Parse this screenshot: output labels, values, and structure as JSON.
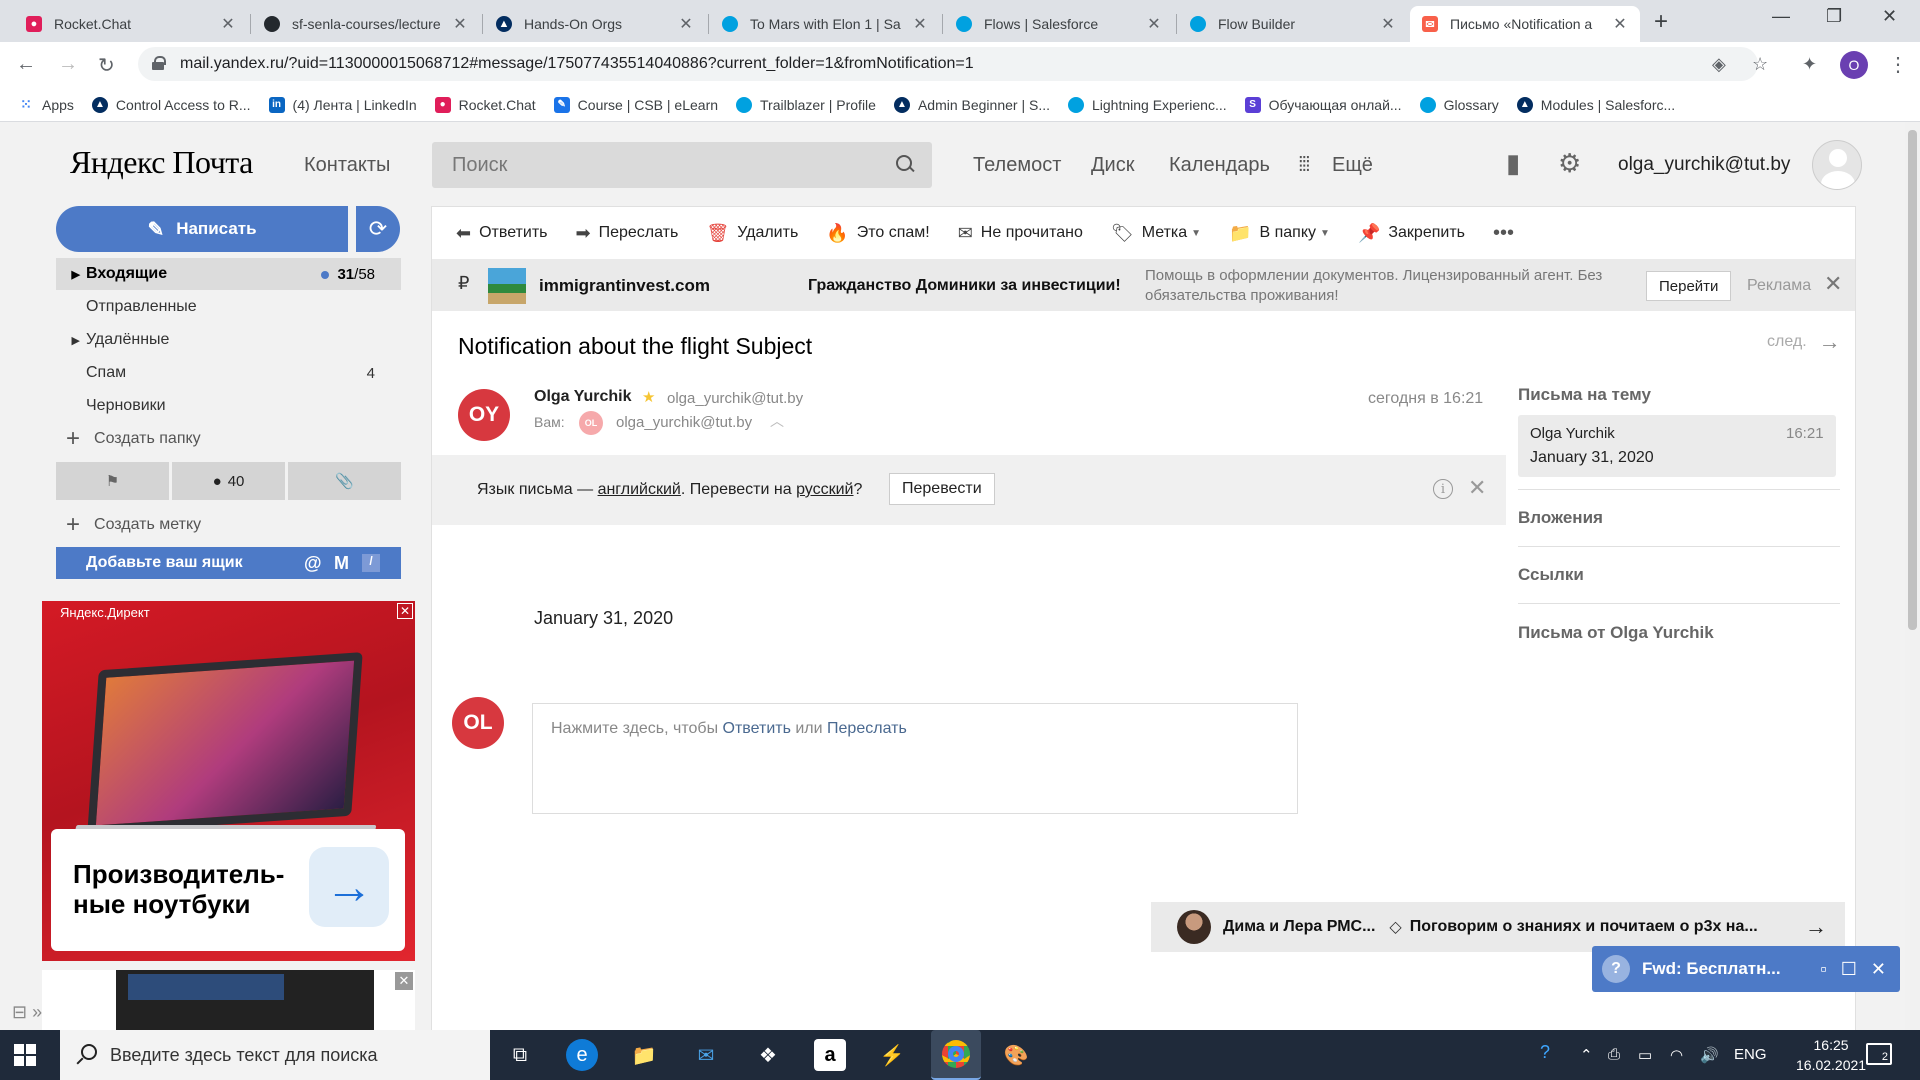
{
  "browser": {
    "tabs": [
      {
        "title": "Rocket.Chat",
        "icon": "rocketchat-icon",
        "color": "#e01e5a"
      },
      {
        "title": "sf-senla-courses/lecture",
        "icon": "github-icon",
        "color": "#24292e"
      },
      {
        "title": "Hands-On Orgs",
        "icon": "trailhead-icon",
        "color": "#032d60"
      },
      {
        "title": "To Mars with Elon 1 | Sa",
        "icon": "salesforce-cloud-icon",
        "color": "#00a1e0"
      },
      {
        "title": "Flows | Salesforce",
        "icon": "salesforce-cloud-icon",
        "color": "#00a1e0"
      },
      {
        "title": "Flow Builder",
        "icon": "salesforce-cloud-icon",
        "color": "#00a1e0"
      },
      {
        "title": "Письмо «Notification a",
        "icon": "yandex-mail-icon",
        "color": "#f8604a",
        "active": true
      }
    ],
    "url": "mail.yandex.ru/?uid=1130000015068712#message/175077435514040886?current_folder=1&fromNotification=1",
    "profile_initial": "O",
    "bookmarks": [
      {
        "label": "Apps",
        "icon": "apps-grid-icon",
        "color": "#4285f4"
      },
      {
        "label": "Control Access to R...",
        "icon": "trailhead-icon",
        "color": "#032d60"
      },
      {
        "label": "(4) Лента | LinkedIn",
        "icon": "linkedin-icon",
        "color": "#0a66c2"
      },
      {
        "label": "Rocket.Chat",
        "icon": "rocketchat-icon",
        "color": "#e01e5a"
      },
      {
        "label": "Course | CSB | eLearn",
        "icon": "elearn-icon",
        "color": "#1a73e8"
      },
      {
        "label": "Trailblazer | Profile",
        "icon": "salesforce-cloud-icon",
        "color": "#00a1e0"
      },
      {
        "label": "Admin Beginner | S...",
        "icon": "trailhead-icon",
        "color": "#032d60"
      },
      {
        "label": "Lightning Experienc...",
        "icon": "salesforce-cloud-icon",
        "color": "#00a1e0"
      },
      {
        "label": "Обучающая онлай...",
        "icon": "s-letter-icon",
        "color": "#5b3fd6"
      },
      {
        "label": "Glossary",
        "icon": "salesforce-cloud-icon",
        "color": "#00a1e0"
      },
      {
        "label": "Modules | Salesforc...",
        "icon": "trailhead-icon",
        "color": "#032d60"
      }
    ]
  },
  "header": {
    "logo_brand": "Яндекс",
    "logo_product": "Почта",
    "contacts": "Контакты",
    "search_placeholder": "Поиск",
    "nav": [
      "Телемост",
      "Диск",
      "Календарь",
      "Ещё"
    ],
    "user_email": "olga_yurchik@tut.by"
  },
  "sidebar": {
    "compose": "Написать",
    "folders": [
      {
        "name": "Входящие",
        "unread": "31",
        "total": "58",
        "selected": true,
        "expandable": true
      },
      {
        "name": "Отправленные"
      },
      {
        "name": "Удалённые",
        "expandable": true
      },
      {
        "name": "Спам",
        "count": "4"
      },
      {
        "name": "Черновики"
      }
    ],
    "create_folder": "Создать папку",
    "filter_unread_count": "40",
    "create_label": "Создать метку",
    "add_mailbox": "Добавьте ваш ящик"
  },
  "ad": {
    "label": "Яндекс.Директ",
    "title": "Производитель-ные ноутбуки",
    "title_line1": "Производитель-",
    "title_line2": "ные ноутбуки"
  },
  "toolbar": {
    "reply": "Ответить",
    "forward": "Переслать",
    "delete": "Удалить",
    "spam": "Это спам!",
    "unread": "Не прочитано",
    "label": "Метка",
    "to_folder": "В папку",
    "pin": "Закрепить"
  },
  "ad_strip": {
    "currency": "₽",
    "domain": "immigrantinvest.com",
    "headline": "Гражданство Доминики за инвестиции!",
    "description": "Помощь в оформлении документов. Лицензированный агент. Без обязательства проживания!",
    "go": "Перейти",
    "label": "Реклама"
  },
  "message": {
    "subject": "Notification about the flight Subject",
    "next": "след.",
    "sender_initials": "OY",
    "sender_name": "Olga Yurchik",
    "sender_email": "olga_yurchik@tut.by",
    "to_label": "Вам:",
    "to_initials": "OL",
    "to_email": "olga_yurchik@tut.by",
    "time": "сегодня в 16:21",
    "translate": {
      "prefix": "Язык письма — ",
      "lang_from": "английский",
      "middle": ". Перевести на ",
      "lang_to": "русский",
      "suffix": "?",
      "button": "Перевести"
    },
    "body": "January 31, 2020",
    "reply_initials": "OL",
    "reply_hint_prefix": "Нажмите здесь, чтобы ",
    "reply_link": "Ответить",
    "reply_or": " или ",
    "forward_link": "Переслать"
  },
  "related": {
    "from": "Дима и Лера РМС...",
    "subject": "Поговорим о знаниях и почитаем о р3х на..."
  },
  "right_panel": {
    "thread_title": "Письма на тему",
    "thread_from": "Olga Yurchik",
    "thread_time": "16:21",
    "thread_subject": "January 31, 2020",
    "attachments": "Вложения",
    "links": "Ссылки",
    "from_sender": "Письма от Olga Yurchik"
  },
  "draft": {
    "title": "Fwd: Бесплатн..."
  },
  "taskbar": {
    "search_placeholder": "Введите здесь текст для поиска",
    "lang": "ENG",
    "time": "16:25",
    "date": "16.02.2021",
    "notifications": "2"
  }
}
